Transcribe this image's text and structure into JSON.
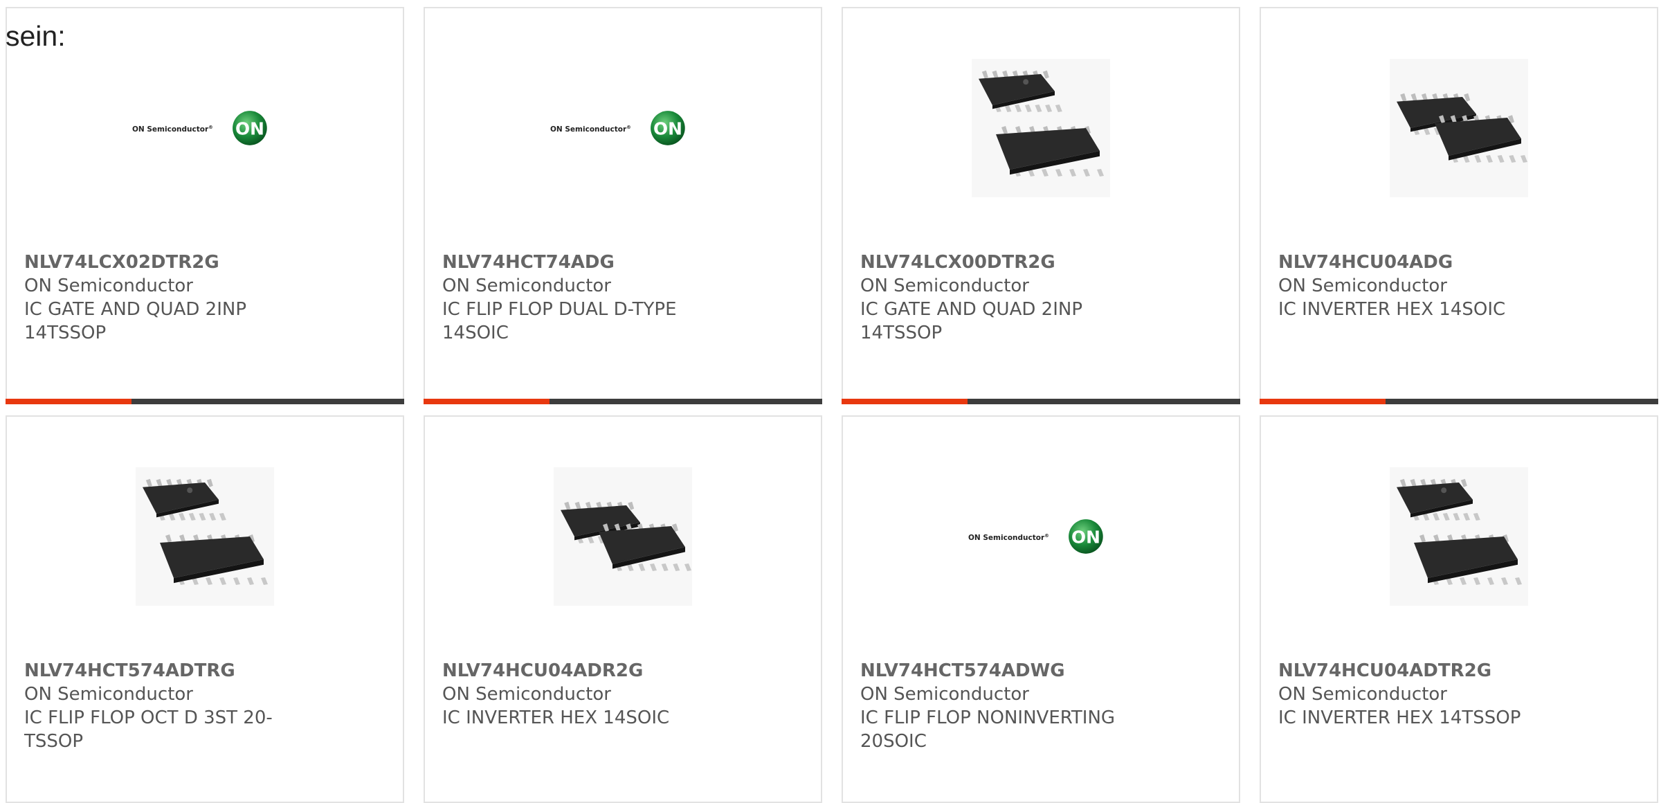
{
  "intro_text": "sein:",
  "brand_logo": {
    "text": "ON Semiconductor",
    "registered": "®",
    "badge": "ON",
    "badge_color": "#1a8a3a"
  },
  "accent_color": "#e8380f",
  "bar_color": "#3d3d3d",
  "products": [
    {
      "part_number": "NLV74LCX02DTR2G",
      "manufacturer": "ON Semiconductor",
      "description": "IC GATE AND QUAD 2INP 14TSSOP",
      "image": "on-semiconductor-logo"
    },
    {
      "part_number": "NLV74HCT74ADG",
      "manufacturer": "ON Semiconductor",
      "description": "IC FLIP FLOP DUAL D-TYPE 14SOIC",
      "image": "on-semiconductor-logo"
    },
    {
      "part_number": "NLV74LCX00DTR2G",
      "manufacturer": "ON Semiconductor",
      "description": "IC GATE AND QUAD 2INP 14TSSOP",
      "image": "tssop-chip-photo"
    },
    {
      "part_number": "NLV74HCU04ADG",
      "manufacturer": "ON Semiconductor",
      "description": "IC INVERTER HEX 14SOIC",
      "image": "soic-chip-photo"
    },
    {
      "part_number": "NLV74HCT574ADTRG",
      "manufacturer": "ON Semiconductor",
      "description": "IC FLIP FLOP OCT D 3ST 20-TSSOP",
      "image": "tssop-chip-photo"
    },
    {
      "part_number": "NLV74HCU04ADR2G",
      "manufacturer": "ON Semiconductor",
      "description": "IC INVERTER HEX 14SOIC",
      "image": "soic-chip-photo"
    },
    {
      "part_number": "NLV74HCT574ADWG",
      "manufacturer": "ON Semiconductor",
      "description": "IC FLIP FLOP NONINVERTING 20SOIC",
      "image": "on-semiconductor-logo"
    },
    {
      "part_number": "NLV74HCU04ADTR2G",
      "manufacturer": "ON Semiconductor",
      "description": "IC INVERTER HEX 14TSSOP",
      "image": "tssop-chip-photo"
    }
  ]
}
